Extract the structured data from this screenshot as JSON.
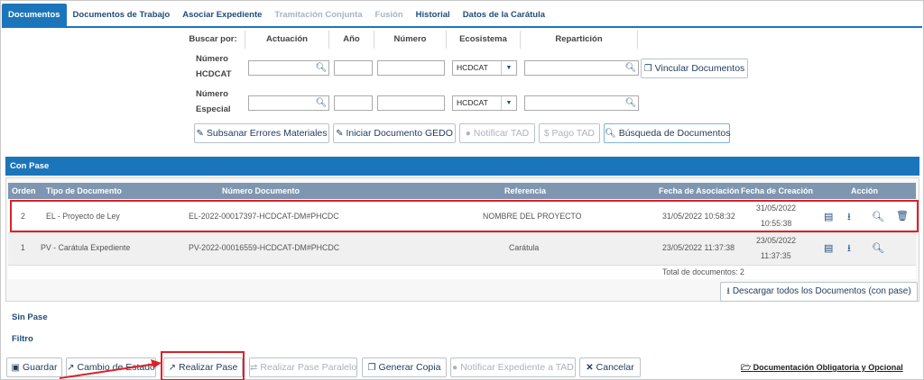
{
  "tabs": [
    "Documentos",
    "Documentos de Trabajo",
    "Asociar Expediente",
    "Tramitación Conjunta",
    "Fusión",
    "Historial",
    "Datos de la Carátula"
  ],
  "search": {
    "label": "Buscar por:",
    "headers": [
      "Actuación",
      "Año",
      "Número",
      "Ecosistema",
      "Repartición"
    ],
    "row1_label": "Número HCDCAT",
    "row2_label": "Número Especial",
    "ecosistema_value": "HCDCAT",
    "vincular": "Vincular Documentos"
  },
  "actions": {
    "subsanar": "Subsanar Errores Materiales",
    "iniciar": "Iniciar Documento GEDO",
    "notificar_tad": "Notificar TAD",
    "pago_tad": "Pago TAD",
    "busqueda": "Búsqueda de Documentos"
  },
  "con_pase": "Con Pase",
  "table": {
    "headers": [
      "Orden",
      "Tipo de Documento",
      "Número Documento",
      "Referencia",
      "Fecha de Asociación",
      "Fecha de Creación",
      "Acción"
    ],
    "rows": [
      {
        "orden": "2",
        "tipo": "EL - Proyecto de Ley",
        "numero": "EL-2022-00017397-HCDCAT-DM#PHCDC",
        "referencia": "NOMBRE DEL PROYECTO",
        "asociacion": "31/05/2022 10:58:32",
        "creacion_fecha": "31/05/2022",
        "creacion_hora": "10:55:38"
      },
      {
        "orden": "1",
        "tipo": "PV - Carátula Expediente",
        "numero": "PV-2022-00016559-HCDCAT-DM#PHCDC",
        "referencia": "Carátula",
        "asociacion": "23/05/2022 11:37:38",
        "creacion_fecha": "23/05/2022",
        "creacion_hora": "11:37:35"
      }
    ],
    "total_label": "Total de documentos:",
    "total_value": "2",
    "descargar": "Descargar todos los Documentos (con pase)"
  },
  "sin_pase": "Sin Pase",
  "filtro": "Filtro",
  "footer": {
    "guardar": "Guardar",
    "cambio": "Cambio de Estado",
    "realizar": "Realizar Pase",
    "paralelo": "Realizar Pase Paralelo",
    "copia": "Generar Copia",
    "notificar": "Notificar Expediente a TAD",
    "cancelar": "Cancelar",
    "doc_link": "Documentación Obligatoria y Opcional"
  },
  "colors": {
    "primary": "#1b75bb",
    "header": "#7f96b0",
    "highlight": "#d9232a"
  }
}
